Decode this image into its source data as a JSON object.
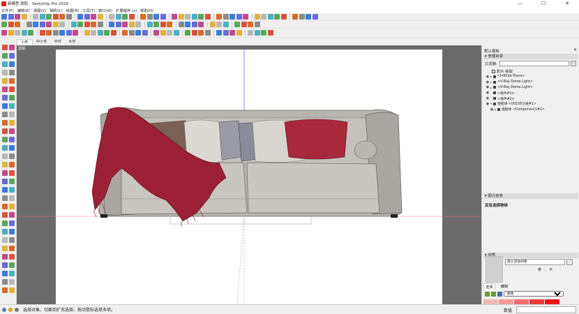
{
  "window": {
    "title": "新模型·锁取 - SketchUp Pro 2020",
    "minimize": "—",
    "maximize": "☐",
    "close": "✕"
  },
  "menu": [
    "文件(F)",
    "编辑(E)",
    "视图(V)",
    "相机(C)",
    "绘图(R)",
    "工具(T)",
    "窗口(W)",
    "扩展程序 (x)",
    "帮助(H)"
  ],
  "scene_tabs": [
    "小件",
    "中小件",
    "中件",
    "大件"
  ],
  "viewport": {
    "camera_label": "透视"
  },
  "tray": {
    "title": "默认面板",
    "close": "✕",
    "outliner": {
      "header": "管理目录",
      "filter_label": "过滤器:",
      "filter_value": "",
      "root": "影片·锁取",
      "rows": [
        {
          "name": "<Infinite Plane>",
          "indent": 0,
          "expand": "▸"
        },
        {
          "name": "<V-Ray Dome Light>",
          "indent": 0,
          "expand": "▸"
        },
        {
          "name": "<V-Ray Dome Light>",
          "indent": 0,
          "expand": "▸"
        },
        {
          "name": "<组件#1>",
          "indent": 0,
          "expand": ""
        },
        {
          "name": "<组件#2>",
          "indent": 0,
          "expand": ""
        },
        {
          "name": "组框体 <00158沙发#1>",
          "indent": 0,
          "expand": "▾"
        },
        {
          "name": "组框体 <Component1#2>",
          "indent": 1,
          "expand": "▸"
        }
      ]
    },
    "entity_info": {
      "header": "图元信息",
      "body": "没有选择物体"
    },
    "materials": {
      "header": "材质",
      "name": "默认空地材质",
      "lang_en": "英",
      "lang_sep": "·,",
      "lang_half": "半",
      "tabs": [
        "选择",
        "编辑"
      ],
      "library": "颜色",
      "swatch_colors": [
        "#f2b8b8",
        "#f29a9a",
        "#f06d6d",
        "#eb3a3a",
        "#e61414"
      ]
    }
  },
  "status": {
    "text": "选择对象。切换到扩充选择。拖动鼠标选择多项。",
    "measure_label": "数值",
    "measure_value": ""
  }
}
